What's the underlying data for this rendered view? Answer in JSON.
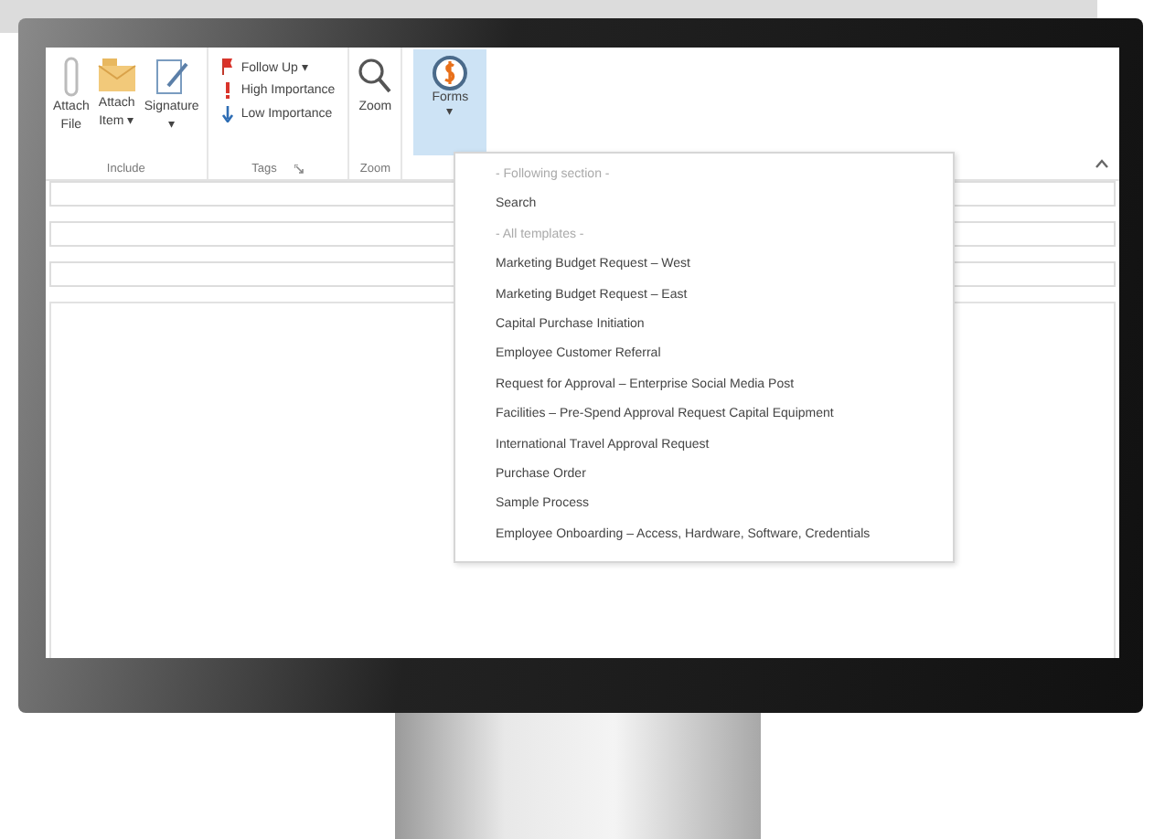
{
  "ribbon": {
    "groups": [
      {
        "label": "Include",
        "launcher": false,
        "buttons": [
          {
            "kind": "paperclip",
            "lines": [
              "Attach",
              "File"
            ]
          },
          {
            "kind": "envelope",
            "lines": [
              "Attach",
              "Item ▾"
            ]
          },
          {
            "kind": "signature",
            "lines": [
              "Signature",
              "▾"
            ]
          }
        ]
      },
      {
        "label": "Tags",
        "launcher": true,
        "items": [
          {
            "kind": "flag",
            "label": "Follow Up ▾"
          },
          {
            "kind": "high",
            "label": "High Importance"
          },
          {
            "kind": "low",
            "label": "Low Importance"
          }
        ]
      },
      {
        "label": "Zoom",
        "launcher": false,
        "buttons": [
          {
            "kind": "magnifier",
            "lines": [
              "Zoom"
            ]
          }
        ]
      }
    ],
    "forms_button": {
      "lines": [
        "Forms",
        "▾"
      ],
      "selected": true
    }
  },
  "menu": {
    "items": [
      {
        "kind": "header",
        "label": "- Following section -"
      },
      {
        "kind": "item",
        "label": "Search"
      },
      {
        "kind": "header",
        "label": "- All templates -"
      },
      {
        "kind": "item",
        "label": "Marketing Budget Request – West"
      },
      {
        "kind": "item",
        "label": "Marketing Budget Request – East"
      },
      {
        "kind": "item",
        "label": "Capital Purchase Initiation"
      },
      {
        "kind": "item",
        "label": "Employee Customer Referral"
      },
      {
        "kind": "item",
        "label": "Request for Approval – Enterprise Social Media Post"
      },
      {
        "kind": "item",
        "label": "Facilities – Pre-Spend Approval Request Capital Equipment"
      },
      {
        "kind": "item",
        "label": "International Travel Approval Request"
      },
      {
        "kind": "item",
        "label": "Purchase Order"
      },
      {
        "kind": "item",
        "label": "Sample Process"
      },
      {
        "kind": "item",
        "label": "Employee Onboarding – Access, Hardware, Software, Credentials"
      }
    ]
  }
}
